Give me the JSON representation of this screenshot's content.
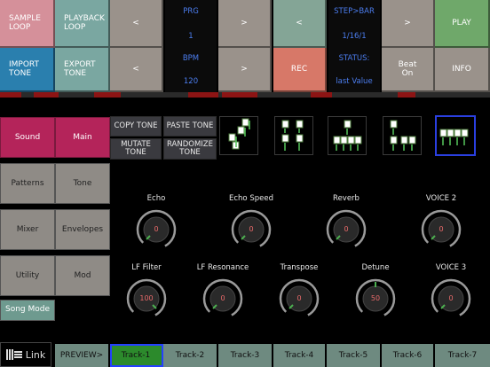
{
  "top_left": {
    "sample_loop": "SAMPLE LOOP",
    "playback_loop": "PLAYBACK LOOP",
    "import_tone": "IMPORT TONE",
    "export_tone": "EXPORT TONE"
  },
  "nav": {
    "prev": "<",
    "next": ">"
  },
  "program": {
    "label": "PRG",
    "value": "1",
    "bpm_label": "BPM",
    "bpm_value": "120"
  },
  "step": {
    "label": "STEP>BAR",
    "value": "1/16/1",
    "status_label": "STATUS:",
    "status_value": "last Value"
  },
  "actions": {
    "rec": "REC",
    "play": "PLAY",
    "beat_on": "Beat On",
    "info": "INFO"
  },
  "tone_actions": {
    "copy": "COPY TONE",
    "paste": "PASTE TONE",
    "mutate": "MUTATE TONE",
    "randomize": "RANDOMIZE TONE"
  },
  "sidebar": {
    "sound": "Sound",
    "main": "Main",
    "patterns": "Patterns",
    "tone": "Tone",
    "mixer": "Mixer",
    "envelopes": "Envelopes",
    "utility": "Utility",
    "mod": "Mod",
    "song_mode": "Song Mode"
  },
  "knobs": {
    "echo": {
      "label": "Echo",
      "value": "0"
    },
    "echo_speed": {
      "label": "Echo Speed",
      "value": "0"
    },
    "reverb": {
      "label": "Reverb",
      "value": "0"
    },
    "voice2": {
      "label": "VOICE 2",
      "value": "0"
    },
    "lf_filter": {
      "label": "LF Filter",
      "value": "100"
    },
    "lf_resonance": {
      "label": "LF Resonance",
      "value": "0"
    },
    "transpose": {
      "label": "Transpose",
      "value": "0"
    },
    "detune": {
      "label": "Detune",
      "value": "50"
    },
    "voice3": {
      "label": "VOICE 3",
      "value": "0"
    }
  },
  "bottom": {
    "link": "Link",
    "preview": "PREVIEW>",
    "tracks": [
      "Track-1",
      "Track-2",
      "Track-3",
      "Track-4",
      "Track-5",
      "Track-6",
      "Track-7"
    ]
  },
  "colors": {
    "accent_blue": "#4c7ef0",
    "sound_tab": "#b4245a",
    "selected_track": "#2c8a2c"
  }
}
